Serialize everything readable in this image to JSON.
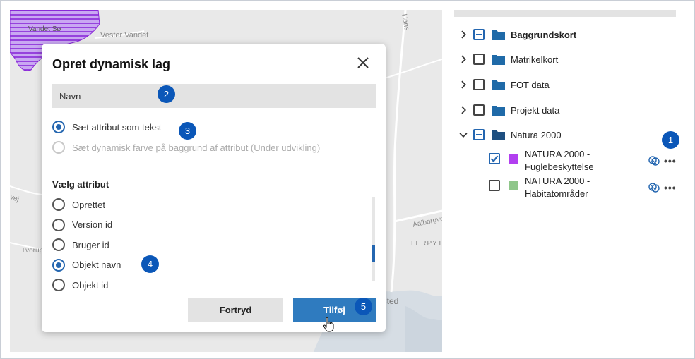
{
  "map": {
    "labels": [
      "Vandet Sø",
      "Vester Vandet",
      "Hans",
      "vej",
      "Tvorup",
      "Aalborgvej",
      "LERPYTT",
      "isted"
    ]
  },
  "layer_tree": {
    "folders": [
      {
        "label": "Baggrundskort",
        "state": "partial",
        "expanded": false,
        "bold": true
      },
      {
        "label": "Matrikelkort",
        "state": "unchecked",
        "expanded": false,
        "bold": false
      },
      {
        "label": "FOT data",
        "state": "unchecked",
        "expanded": false,
        "bold": false
      },
      {
        "label": "Projekt data",
        "state": "unchecked",
        "expanded": false,
        "bold": false
      },
      {
        "label": "Natura 2000",
        "state": "partial",
        "expanded": true,
        "bold": false
      }
    ],
    "layers": [
      {
        "label": "NATURA 2000 - Fuglebeskyttelse",
        "checked": true,
        "color": "#b23ff0"
      },
      {
        "label": "NATURA 2000 - Habitatområder",
        "checked": false,
        "color": "#8fc68a"
      }
    ],
    "more_icon": "ellipsis-icon",
    "style_icon": "layer-style-icon"
  },
  "dialog": {
    "title": "Opret dynamisk lag",
    "name_placeholder": "Navn",
    "mode_options": [
      {
        "label": "Sæt attribut som tekst",
        "selected": true,
        "disabled": false
      },
      {
        "label": "Sæt dynamisk farve på baggrund af attribut (Under udvikling)",
        "selected": false,
        "disabled": true
      }
    ],
    "attribute_section_label": "Vælg attribut",
    "attributes": [
      {
        "label": "Oprettet",
        "selected": false
      },
      {
        "label": "Version id",
        "selected": false
      },
      {
        "label": "Bruger id",
        "selected": false
      },
      {
        "label": "Objekt navn",
        "selected": true
      },
      {
        "label": "Objekt id",
        "selected": false
      }
    ],
    "cancel_label": "Fortryd",
    "add_label": "Tilføj"
  },
  "badges": [
    "1",
    "2",
    "3",
    "4",
    "5"
  ],
  "colors": {
    "accent": "#2466b0",
    "badge": "#0b57b8",
    "primary_button": "#2f7bbf",
    "folder": "#1f6aa8",
    "map_background": "#e9e9e9"
  }
}
